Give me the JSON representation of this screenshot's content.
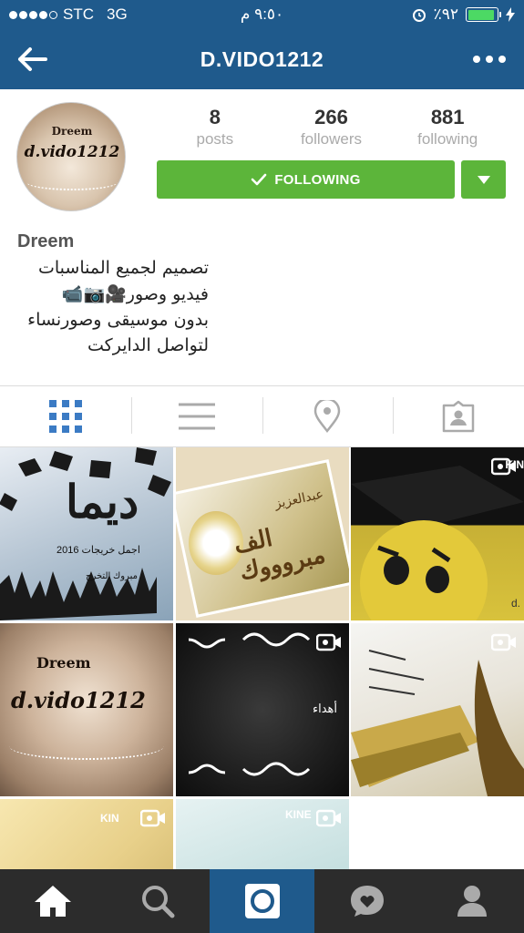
{
  "status": {
    "carrier": "STC",
    "network": "3G",
    "time": "٩:٥٠ م",
    "battery": "٪٩٢",
    "battery_level": 0.92
  },
  "header": {
    "title": "D.VIDO1212",
    "back_icon": "back-arrow-icon",
    "more_icon": "more-dots-icon"
  },
  "profile": {
    "avatar_top_text": "Dreem",
    "avatar_main_text": "d.vido1212",
    "stats": [
      {
        "value": "8",
        "label": "posts"
      },
      {
        "value": "266",
        "label": "followers"
      },
      {
        "value": "881",
        "label": "following"
      }
    ],
    "follow_button": "FOLLOWING",
    "name": "Dreem",
    "bio_lines": [
      "تصميم لجميع المناسبات",
      "فيديو وصور🎥📷📹",
      "بدون موسيقى وصورنساء",
      "لتواصل الدايركت"
    ]
  },
  "tabs": [
    "grid-icon",
    "list-icon",
    "location-pin-icon",
    "tagged-person-icon"
  ],
  "posts": [
    {
      "text_main": "ديما",
      "text_sub": "اجمل خريجات 2016",
      "text_sub2": "مبروك التخرج",
      "video": false
    },
    {
      "text_main": "الف مبروووك",
      "text_sub": "عبدالعزيز",
      "video": false
    },
    {
      "text_main": "",
      "text_sub": "KIN",
      "text_sub2": "d.",
      "video": true
    },
    {
      "text_main": "d.vido1212",
      "text_sub": "Dreem",
      "video": false
    },
    {
      "text_main": "أهداء",
      "video": true
    },
    {
      "text_main": "",
      "video": true
    },
    {
      "text_main": "",
      "text_sub": "KIN",
      "video": true
    },
    {
      "text_main": "",
      "text_sub": "KINE",
      "video": true
    }
  ],
  "bottom_nav": [
    "home-icon",
    "search-icon",
    "camera-icon",
    "activity-heart-icon",
    "profile-icon"
  ],
  "colors": {
    "header": "#1f5a8c",
    "follow_green": "#5cb53a",
    "bottom_bar": "#2c2c2c",
    "active_tab_blue": "#3b7bc4"
  }
}
